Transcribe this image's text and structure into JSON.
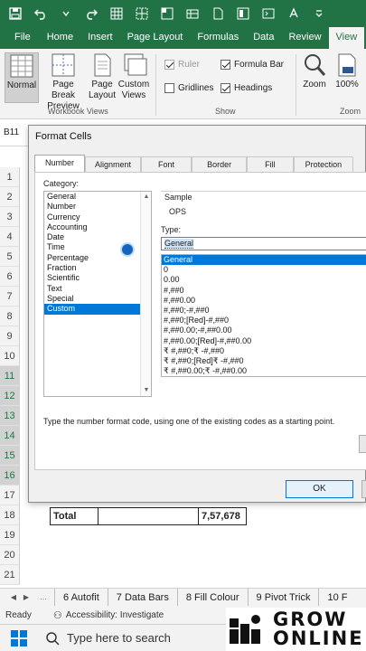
{
  "ribbon_tabs": [
    "File",
    "Home",
    "Insert",
    "Page Layout",
    "Formulas",
    "Data",
    "Review",
    "View"
  ],
  "active_tab": "View",
  "ribbon": {
    "normal": "Normal",
    "page_break_1": "Page Break",
    "page_break_2": "Preview",
    "page_layout_1": "Page",
    "page_layout_2": "Layout",
    "custom_views_1": "Custom",
    "custom_views_2": "Views",
    "workbook_views_label": "Workbook Views",
    "ruler": "Ruler",
    "formula_bar": "Formula Bar",
    "gridlines": "Gridlines",
    "headings": "Headings",
    "show_label": "Show",
    "zoom": "Zoom",
    "zoom_100": "100%",
    "zoom_group_label": "Zoom",
    "ruler_checked": true,
    "formula_bar_checked": true,
    "gridlines_checked": false,
    "headings_checked": true
  },
  "name_box": "B11",
  "row_numbers": [
    "1",
    "2",
    "3",
    "4",
    "5",
    "6",
    "7",
    "8",
    "9",
    "10",
    "11",
    "12",
    "13",
    "14",
    "15",
    "16",
    "17",
    "18",
    "19",
    "20",
    "21"
  ],
  "highlighted_rows": [
    "11",
    "12",
    "13",
    "14",
    "15",
    "16"
  ],
  "total_row": {
    "label": "Total",
    "value": "7,57,678"
  },
  "dialog": {
    "title": "Format Cells",
    "tabs": [
      "Number",
      "Alignment",
      "Font",
      "Border",
      "Fill",
      "Protection"
    ],
    "active_tab": "Number",
    "category_label": "Category:",
    "categories": [
      "General",
      "Number",
      "Currency",
      "Accounting",
      "Date",
      "Time",
      "Percentage",
      "Fraction",
      "Scientific",
      "Text",
      "Special",
      "Custom"
    ],
    "selected_category": "Custom",
    "sample_label": "Sample",
    "sample_value": "OPS",
    "type_label": "Type:",
    "type_value": "General",
    "formats": [
      "General",
      "0",
      "0.00",
      "#,##0",
      "#,##0.00",
      "#,##0;-#,##0",
      "#,##0;[Red]-#,##0",
      "#,##0.00;-#,##0.00",
      "#,##0.00;[Red]-#,##0.00",
      "₹ #,##0;₹ -#,##0",
      "₹ #,##0;[Red]₹ -#,##0",
      "₹ #,##0.00;₹ -#,##0.00"
    ],
    "selected_format": "General",
    "hint": "Type the number format code, using one of the existing codes as a starting point.",
    "ok_label": "OK"
  },
  "sheet_tabs": [
    "6 Autofit",
    "7 Data Bars",
    "8 Fill Colour",
    "9 Pivot Trick",
    "10 F"
  ],
  "status": {
    "ready": "Ready",
    "accessibility": "Accessibility: Investigate"
  },
  "taskbar": {
    "search_placeholder": "Type here to search"
  },
  "brand": {
    "line1": "GROW",
    "line2": "ONLINE"
  },
  "colors": {
    "excel_green": "#217346",
    "selection_blue": "#0078d7"
  }
}
